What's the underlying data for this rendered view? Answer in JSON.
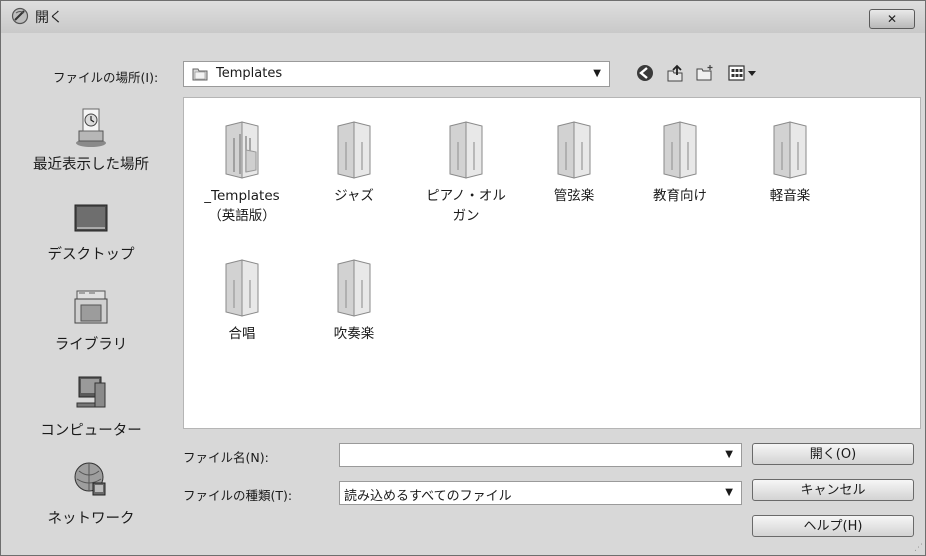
{
  "window": {
    "title": "開く",
    "close_label": "✕"
  },
  "lookin": {
    "label": "ファイルの場所(I):",
    "value": "Templates"
  },
  "places": [
    {
      "label": "最近表示した場所",
      "icon": "recent-places-icon"
    },
    {
      "label": "デスクトップ",
      "icon": "desktop-icon"
    },
    {
      "label": "ライブラリ",
      "icon": "libraries-icon"
    },
    {
      "label": "コンピューター",
      "icon": "computer-icon"
    },
    {
      "label": "ネットワーク",
      "icon": "network-icon"
    }
  ],
  "files": [
    {
      "line1": "_Templates",
      "line2": "（英語版）"
    },
    {
      "line1": "ジャズ",
      "line2": ""
    },
    {
      "line1": "ピアノ・オル",
      "line2": "ガン"
    },
    {
      "line1": "管弦楽",
      "line2": ""
    },
    {
      "line1": "教育向け",
      "line2": ""
    },
    {
      "line1": "軽音楽",
      "line2": ""
    },
    {
      "line1": "合唱",
      "line2": ""
    },
    {
      "line1": "吹奏楽",
      "line2": ""
    }
  ],
  "filename": {
    "label": "ファイル名(N):",
    "value": ""
  },
  "filetype": {
    "label": "ファイルの種類(T):",
    "value": "読み込めるすべてのファイル"
  },
  "buttons": {
    "open": "開く(O)",
    "cancel": "キャンセル",
    "help": "ヘルプ(H)"
  }
}
